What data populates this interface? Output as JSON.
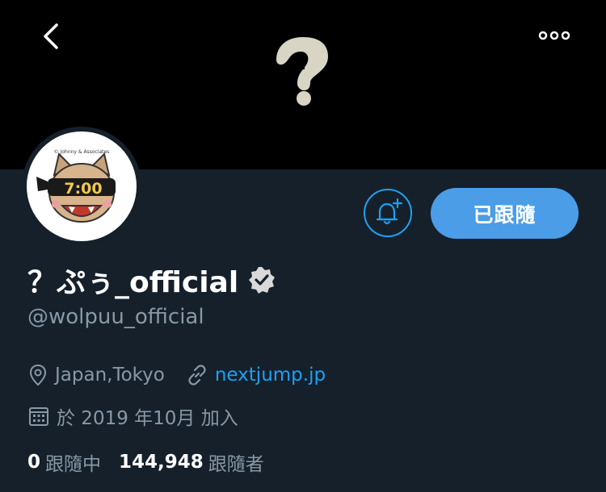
{
  "header": {
    "back_icon": "chevron-left-icon",
    "more_icon": "more-dots-icon",
    "banner_mark": "question-mark-logo"
  },
  "avatar": {
    "copyright": "© Johnny & Associates",
    "clock_text": "7:00"
  },
  "actions": {
    "notify_icon": "bell-plus-icon",
    "follow_label": "已跟隨"
  },
  "profile": {
    "display_name": "？ぷぅ_official",
    "verified_icon": "verified-badge-icon",
    "handle": "@wolpuu_official",
    "location": "Japan,Tokyo",
    "website": "nextjump.jp",
    "joined": "於 2019 年10月 加入"
  },
  "stats": {
    "following_count": "0",
    "following_label": "跟隨中",
    "followers_count": "144,948",
    "followers_label": "跟隨者"
  },
  "colors": {
    "background": "#15202b",
    "banner": "#000000",
    "accent": "#1da1f2",
    "button": "#4a9de6",
    "muted_text": "#8899a6"
  }
}
